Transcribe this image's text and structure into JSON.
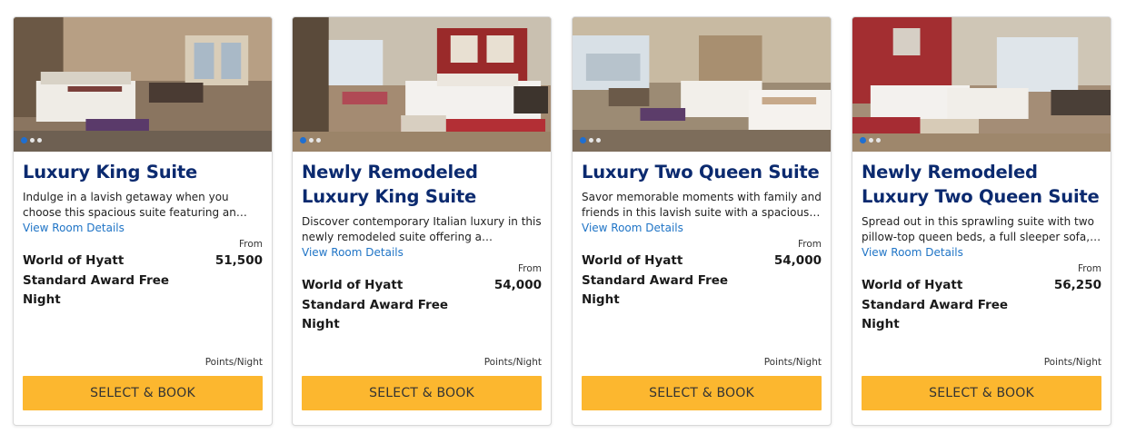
{
  "rooms": [
    {
      "title": "Luxury King Suite",
      "description": "Indulge in a lavish getaway when you choose this spacious suite featuring an open bedroo…",
      "details_link": "View Room Details",
      "from_label": "From",
      "award_name": "World of Hyatt Standard Award Free Night",
      "points": "51,500",
      "points_unit": "Points/Night",
      "button_label": "SELECT & BOOK",
      "image_slides": 3,
      "active_slide": 1
    },
    {
      "title": "Newly Remodeled Luxury King Suite",
      "description": "Discover contemporary Italian luxury in this newly remodeled suite offering a spacious…",
      "details_link": "View Room Details",
      "from_label": "From",
      "award_name": "World of Hyatt Standard Award Free Night",
      "points": "54,000",
      "points_unit": "Points/Night",
      "button_label": "SELECT & BOOK",
      "image_slides": 3,
      "active_slide": 1
    },
    {
      "title": "Luxury Two Queen Suite",
      "description": "Savor memorable moments with family and friends in this lavish suite with a spacious…",
      "details_link": "View Room Details",
      "from_label": "From",
      "award_name": "World of Hyatt Standard Award Free Night",
      "points": "54,000",
      "points_unit": "Points/Night",
      "button_label": "SELECT & BOOK",
      "image_slides": 3,
      "active_slide": 1
    },
    {
      "title": "Newly Remodeled Luxury Two Queen Suite",
      "description": "Spread out in this sprawling suite with two pillow-top queen beds, a full sleeper sofa, a…",
      "details_link": "View Room Details",
      "from_label": "From",
      "award_name": "World of Hyatt Standard Award Free Night",
      "points": "56,250",
      "points_unit": "Points/Night",
      "button_label": "SELECT & BOOK",
      "image_slides": 3,
      "active_slide": 1
    }
  ],
  "colors": {
    "title": "#0b2a6f",
    "link": "#1f74c6",
    "button": "#fcb72f",
    "slide_dot_active": "#1f6fd1"
  }
}
